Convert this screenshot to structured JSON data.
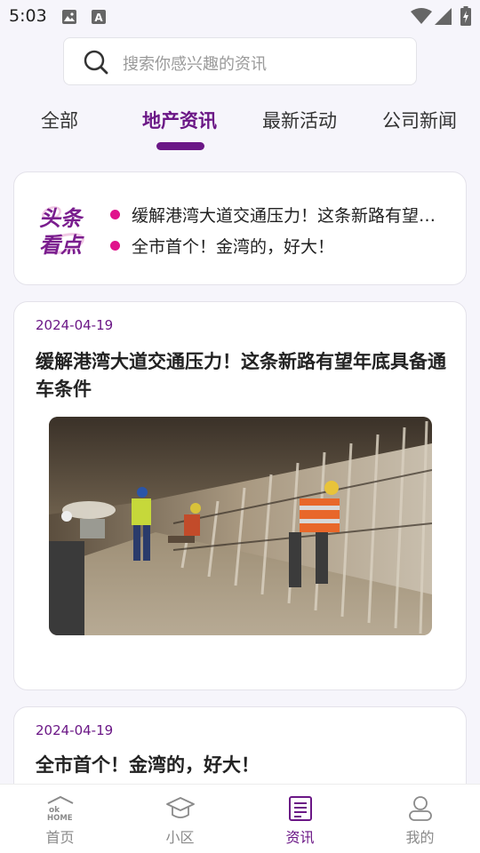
{
  "status_bar": {
    "time": "5:03",
    "icons": [
      "image-icon",
      "a-font-icon",
      "wifi-icon",
      "signal-icon",
      "battery-charging-icon"
    ]
  },
  "search": {
    "placeholder": "搜索你感兴趣的资讯",
    "icon": "search-icon"
  },
  "tabs": [
    {
      "label": "全部",
      "active": false
    },
    {
      "label": "地产资讯",
      "active": true
    },
    {
      "label": "最新活动",
      "active": false
    },
    {
      "label": "公司新闻",
      "active": false
    }
  ],
  "headlines": {
    "logo_text_line1": "头条",
    "logo_text_line2": "看点",
    "items": [
      "缓解港湾大道交通压力！这条新路有望年底具备通车条件",
      "全市首个！金湾的，好大！"
    ]
  },
  "news": [
    {
      "date": "2024-04-19",
      "title": "缓解港湾大道交通压力！这条新路有望年底具备通车条件",
      "image": "tunnel-construction-workers-photo"
    },
    {
      "date": "2024-04-19",
      "title": "全市首个！金湾的，好大！"
    }
  ],
  "bottom_nav": [
    {
      "label": "首页",
      "icon": "ok-home-logo-icon",
      "active": false
    },
    {
      "label": "小区",
      "icon": "graduation-cap-icon",
      "active": false
    },
    {
      "label": "资讯",
      "icon": "news-document-icon",
      "active": true
    },
    {
      "label": "我的",
      "icon": "person-icon",
      "active": false
    }
  ],
  "colors": {
    "accent": "#6b1786",
    "bullet": "#e0138c",
    "background": "#f6f5fb"
  }
}
